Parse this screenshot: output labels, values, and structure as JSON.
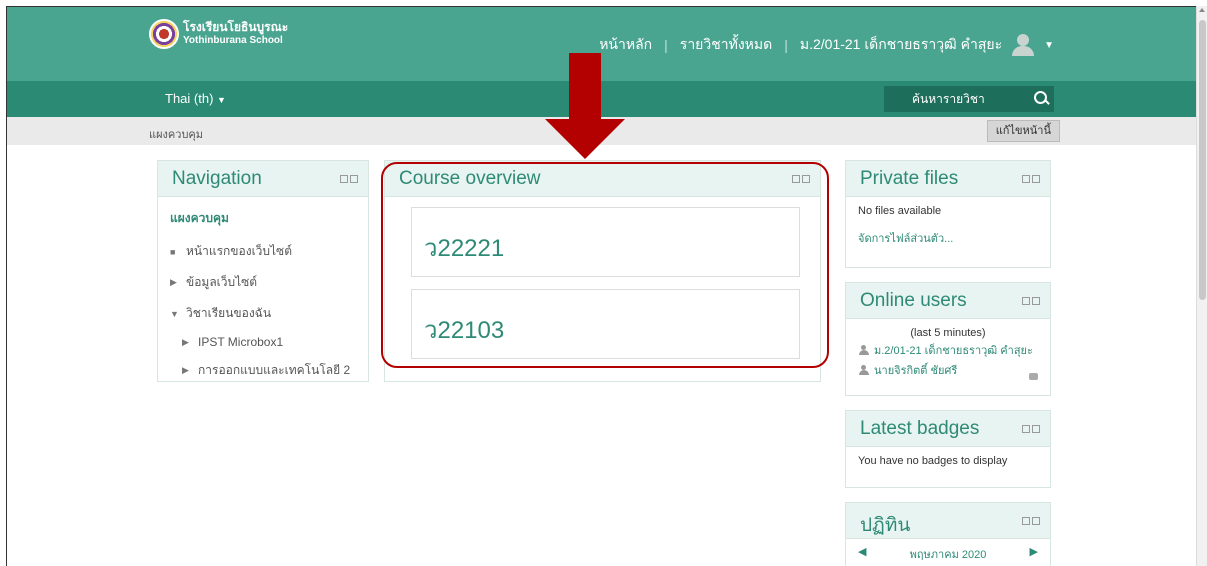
{
  "header": {
    "logo_th": "โรงเรียนโยธินบูรณะ",
    "logo_en": "Yothinburana School",
    "nav": [
      "หน้าหลัก",
      "รายวิชาทั้งหมด"
    ],
    "user_name": "ม.2/01-21 เด็กชายธราวุฒิ คำสุยะ"
  },
  "subbar": {
    "language": "Thai (th)",
    "search_label": "ค้นหารายวิชา"
  },
  "breadcrumb": "แผงควบคุม",
  "edit_button": "แก้ไขหน้านี้",
  "navigation": {
    "title": "Navigation",
    "root": "แผงควบคุม",
    "items": [
      {
        "label": "หน้าแรกของเว็บไซต์",
        "bullet": "■"
      },
      {
        "label": "ข้อมูลเว็บไซต์",
        "bullet": "▶"
      },
      {
        "label": "วิชาเรียนของฉัน",
        "bullet": "▼"
      }
    ],
    "courses": [
      "IPST Microbox1",
      "การออกแบบและเทคโนโลยี 2"
    ]
  },
  "course_overview": {
    "title": "Course overview",
    "courses": [
      "ว22221",
      "ว22103"
    ]
  },
  "private_files": {
    "title": "Private files",
    "empty": "No files available",
    "manage_link": "จัดการไฟล์ส่วนตัว..."
  },
  "online_users": {
    "title": "Online users",
    "period": "(last 5 minutes)",
    "users": [
      "ม.2/01-21 เด็กชายธราวุฒิ คำสุยะ",
      "นายจิรกิตติ์ ชัยศรี"
    ]
  },
  "latest_badges": {
    "title": "Latest badges",
    "empty": "You have no badges to display"
  },
  "calendar": {
    "title": "ปฏิทิน",
    "month": "พฤษภาคม 2020"
  },
  "colors": {
    "topbar": "#4aa590",
    "subbar": "#2a8a73",
    "accent": "#2e8a76",
    "highlight": "#b30000"
  }
}
